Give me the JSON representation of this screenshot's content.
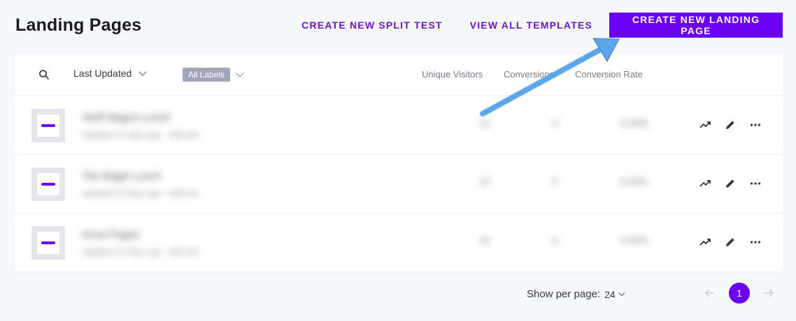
{
  "page": {
    "title": "Landing Pages"
  },
  "header": {
    "split_test_label": "CREATE NEW SPLIT TEST",
    "templates_label": "VIEW ALL TEMPLATES",
    "create_label": "CREATE NEW LANDING PAGE"
  },
  "toolbar": {
    "search_icon": "search-icon",
    "sort_value": "Last Updated",
    "labels_filter": "All Labels",
    "columns": [
      "Unique Visitors",
      "Conversions",
      "Conversion Rate"
    ]
  },
  "rows": [
    {
      "name": "Stuff Wagon Lunch",
      "sub": "Updated 12 days ago · Edit link",
      "visitors": "12",
      "conversions": "0",
      "rate": "0.00%"
    },
    {
      "name": "The Bagel Lunch",
      "sub": "Updated 12 days ago · Edit link",
      "visitors": "10",
      "conversions": "0",
      "rate": "0.00%"
    },
    {
      "name": "Grow Pages",
      "sub": "Updated 14 days ago · Edit link",
      "visitors": "10",
      "conversions": "0",
      "rate": "0.00%"
    }
  ],
  "footer": {
    "per_page_label": "Show per page:",
    "per_page_value": "24",
    "current_page": "1"
  },
  "colors": {
    "accent": "#6a00f4",
    "link": "#6a11d8",
    "annotation_arrow": "#5aa6ea"
  }
}
